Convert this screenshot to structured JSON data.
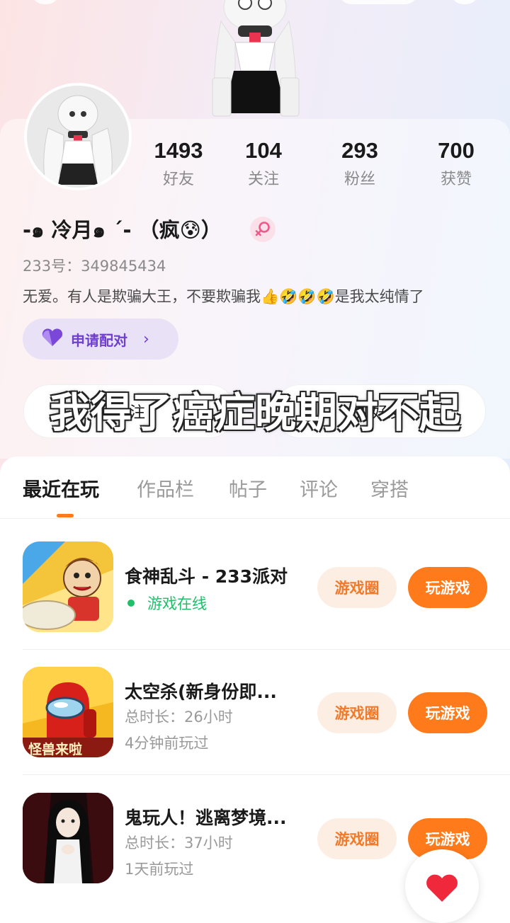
{
  "profile": {
    "stats": [
      {
        "value": "1493",
        "label": "好友"
      },
      {
        "value": "104",
        "label": "关注"
      },
      {
        "value": "293",
        "label": "粉丝"
      },
      {
        "value": "700",
        "label": "获赞"
      }
    ],
    "nickname": "-๑ 冷月๑ ´-  （疯😰）",
    "gender_icon": "female-icon",
    "uid": "233号：349845434",
    "bio": "无爱。有人是欺骗大王，不要欺骗我👍🤣🤣🤣是我太纯情了",
    "match_button": "申请配对",
    "follow_button": "关注",
    "friend_button": "加好友"
  },
  "overlay_subtitle": "我得了癌症晚期对不起",
  "tabs": [
    "最近在玩",
    "作品栏",
    "帖子",
    "评论",
    "穿搭"
  ],
  "games": [
    {
      "title": "食神乱斗 - 233派对",
      "status": "游戏在线",
      "circle_label": "游戏圈",
      "play_label": "玩游戏"
    },
    {
      "title": "太空杀(新身份即...",
      "duration": "总时长：26小时",
      "last_played": "4分钟前玩过",
      "circle_label": "游戏圈",
      "play_label": "玩游戏",
      "icon_caption": "怪兽来啦"
    },
    {
      "title": "鬼玩人！逃离梦境...",
      "duration": "总时长：37小时",
      "last_played": "1天前玩过",
      "circle_label": "游戏圈",
      "play_label": "玩游戏"
    }
  ],
  "colors": {
    "accent": "#ff7a1a",
    "online": "#1fbf6a",
    "match": "#6f3fd0"
  },
  "icons": {
    "like": "heart-icon",
    "match": "heart-icon",
    "chevron": "chevron-right-icon"
  }
}
